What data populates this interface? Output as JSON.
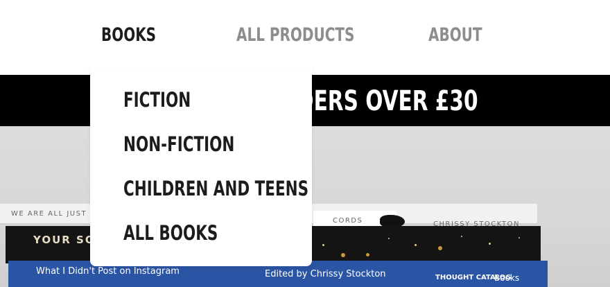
{
  "nav": {
    "items": [
      {
        "label": "BOOKS",
        "active": true
      },
      {
        "label": "ALL PRODUCTS",
        "active": false
      },
      {
        "label": "ABOUT",
        "active": false
      }
    ]
  },
  "banner": {
    "visible_text": "DERS OVER £30"
  },
  "dropdown": {
    "items": [
      {
        "label": "FICTION"
      },
      {
        "label": "NON-FICTION"
      },
      {
        "label": "CHILDREN AND TEENS"
      },
      {
        "label": "ALL BOOKS"
      }
    ]
  },
  "hero": {
    "book_spines": {
      "top_left": "WE ARE ALL JUST",
      "cords": "CORDS",
      "chrissy_top": "CHRISSY STOCKTON",
      "your_so": "YOUR SO",
      "instagram_title": "What I Didn't Post on Instagram",
      "instagram_editor": "Edited by Chrissy Stockton",
      "publisher": "THOUGHT CATALOG",
      "publisher_suffix": "Books"
    }
  },
  "colors": {
    "banner_bg": "#000000",
    "nav_active": "#1c1c1c",
    "nav_inactive": "#8d8d8d",
    "book_blue": "#2a54a4"
  }
}
